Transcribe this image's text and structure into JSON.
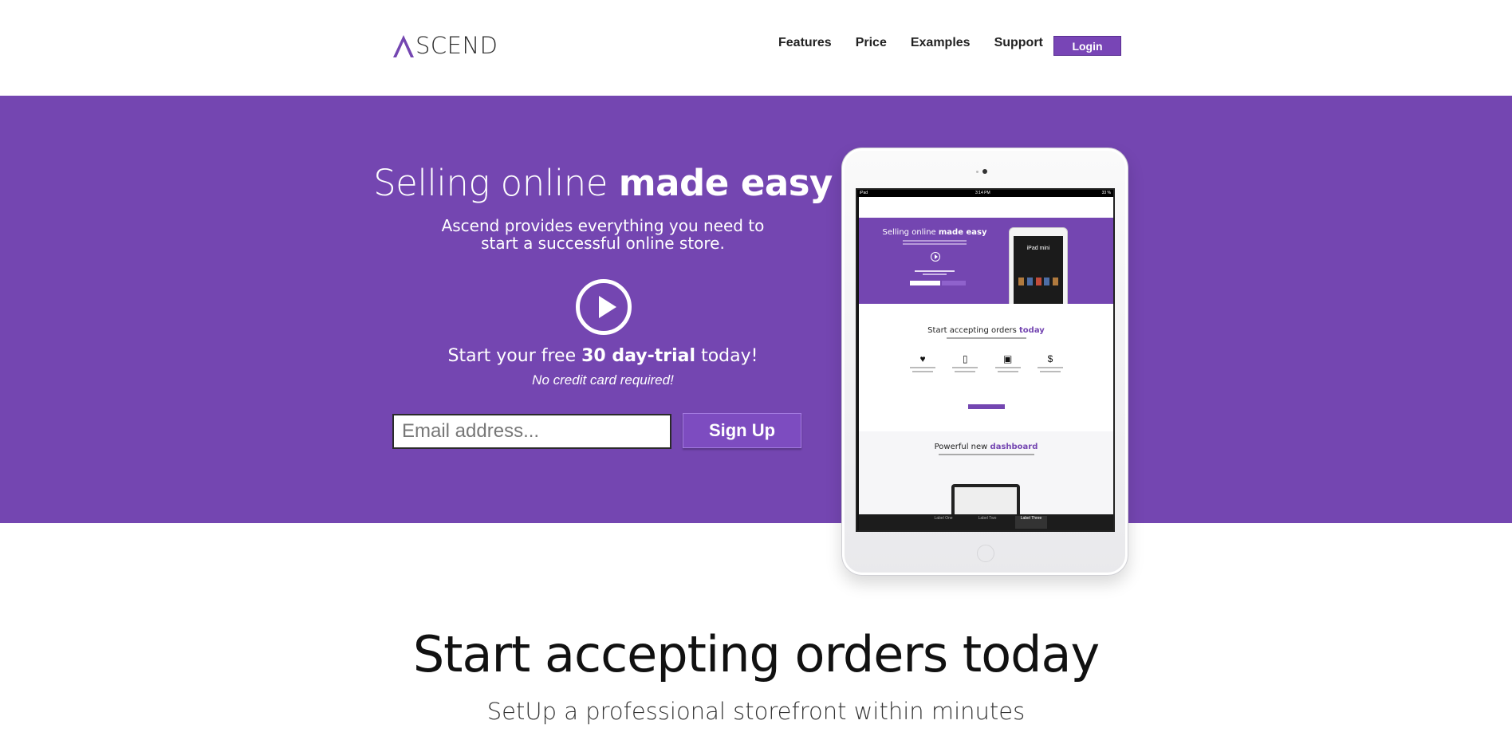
{
  "header": {
    "logo_text": "SCEND",
    "nav": [
      "Features",
      "Price",
      "Examples",
      "Support"
    ],
    "login_label": "Login"
  },
  "hero": {
    "title_regular": "Selling online ",
    "title_bold": "made easy",
    "subtitle_line1": "Ascend provides everything you need to",
    "subtitle_line2": "start a successful online store.",
    "trial_prefix": "Start your free ",
    "trial_bold": "30 day-trial",
    "trial_suffix": " today!",
    "no_card": "No credit card required!",
    "email_placeholder": "Email address...",
    "signup_label": "Sign Up"
  },
  "device_preview": {
    "status_left": "iPad",
    "status_time": "3:14 PM",
    "status_right": "33 %",
    "hero_title_regular": "Selling online ",
    "hero_title_bold": "made easy",
    "inner_ipad_title": "iPad mini",
    "section1_regular": "Start accepting orders ",
    "section1_bold": "today",
    "section2_regular": "Powerful new ",
    "section2_bold": "dashboard",
    "tabs": [
      "Label One",
      "Label Two",
      "Label Three"
    ]
  },
  "section": {
    "title": "Start accepting orders today",
    "subtitle": "SetUp a professional storefront within minutes"
  },
  "colors": {
    "brand_purple": "#7446b1",
    "button_purple": "#7d4cc0"
  }
}
